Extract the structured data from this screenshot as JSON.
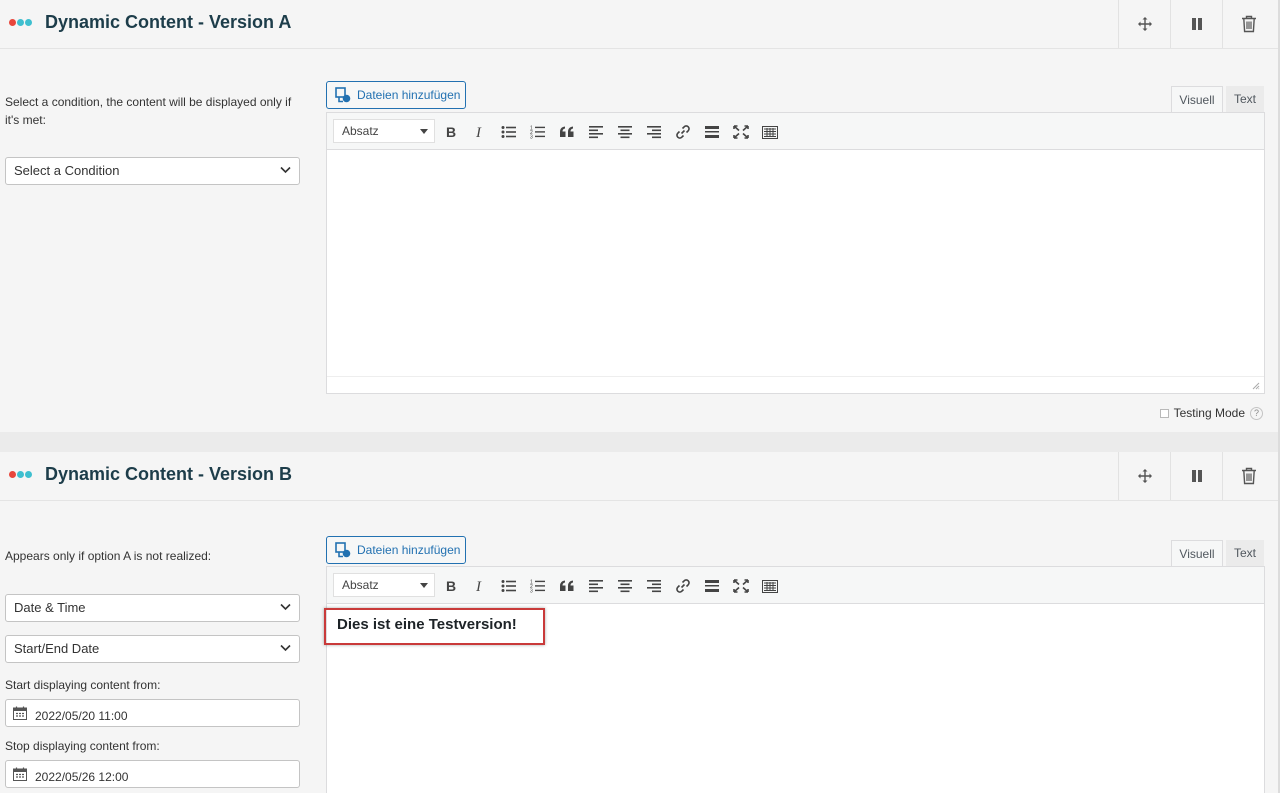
{
  "colors": {
    "dot1": "#e8473c",
    "dot2": "#3ebfcf",
    "dot3": "#3ebfcf",
    "title": "#1d3d4a",
    "media_button": "#2271b1",
    "highlight_border": "#c93a3a"
  },
  "header_actions": {
    "move_icon": "move-icon",
    "pause_icon": "pause-icon",
    "delete_icon": "trash-icon"
  },
  "version_a": {
    "title": "Dynamic Content - Version A",
    "condition_description": "Select a condition, the content will be displayed only if it's met:",
    "condition_select_value": "Select a Condition",
    "editor": {
      "media_button_label": "Dateien hinzufügen",
      "tab_visual": "Visuell",
      "tab_text": "Text",
      "format_select": "Absatz",
      "content": ""
    },
    "testing_mode_label": "Testing Mode",
    "testing_mode_help": "?"
  },
  "version_b": {
    "title": "Dynamic Content - Version B",
    "condition_description": "Appears only if option A is not realized:",
    "condition_type_value": "Date & Time",
    "condition_subtype_value": "Start/End Date",
    "start_label": "Start displaying content from:",
    "start_value": "2022/05/20 11:00",
    "stop_label": "Stop displaying content from:",
    "stop_value": "2022/05/26 12:00",
    "editor": {
      "media_button_label": "Dateien hinzufügen",
      "tab_visual": "Visuell",
      "tab_text": "Text",
      "format_select": "Absatz",
      "content": "Dies ist eine Testversion!"
    }
  },
  "toolbar_buttons": [
    "bold-icon",
    "italic-icon",
    "bullet-list-icon",
    "numbered-list-icon",
    "blockquote-icon",
    "align-left-icon",
    "align-center-icon",
    "align-right-icon",
    "link-icon",
    "read-more-icon",
    "fullscreen-icon",
    "toolbar-toggle-icon"
  ]
}
